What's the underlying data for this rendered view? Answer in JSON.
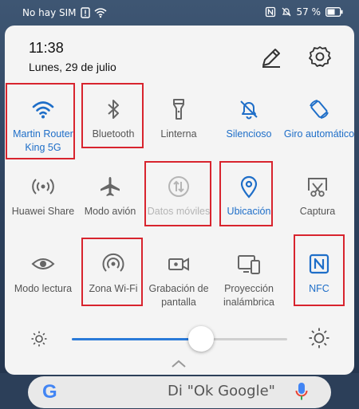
{
  "status_bar": {
    "carrier": "No hay SIM",
    "battery": "57 %"
  },
  "header": {
    "time": "11:38",
    "date": "Lunes, 29 de julio"
  },
  "tiles": [
    {
      "id": "wifi",
      "label": "Martin Router King 5G",
      "state": "on"
    },
    {
      "id": "bluetooth",
      "label": "Bluetooth",
      "state": "off"
    },
    {
      "id": "flashlight",
      "label": "Linterna",
      "state": "off"
    },
    {
      "id": "silent",
      "label": "Silencioso",
      "state": "on"
    },
    {
      "id": "rotate",
      "label": "Giro automático",
      "state": "on"
    },
    {
      "id": "huawei-share",
      "label": "Huawei Share",
      "state": "off"
    },
    {
      "id": "airplane",
      "label": "Modo avión",
      "state": "off"
    },
    {
      "id": "mobile-data",
      "label": "Datos móviles",
      "state": "disabled"
    },
    {
      "id": "location",
      "label": "Ubicación",
      "state": "on"
    },
    {
      "id": "screenshot",
      "label": "Captura",
      "state": "off"
    },
    {
      "id": "reading-mode",
      "label": "Modo lectura",
      "state": "off"
    },
    {
      "id": "hotspot",
      "label": "Zona Wi-Fi",
      "state": "off"
    },
    {
      "id": "screen-record",
      "label": "Grabación de pantalla",
      "state": "off"
    },
    {
      "id": "wireless-projection",
      "label": "Proyección inalámbrica",
      "state": "off"
    },
    {
      "id": "nfc",
      "label": "NFC",
      "state": "on"
    }
  ],
  "brightness": {
    "level": 0.6
  },
  "search_bar": {
    "hint": "Di \"Ok Google\""
  },
  "colors": {
    "accent": "#1e6ec8",
    "highlight": "#d8242e",
    "panel": "#f4f4f4"
  }
}
